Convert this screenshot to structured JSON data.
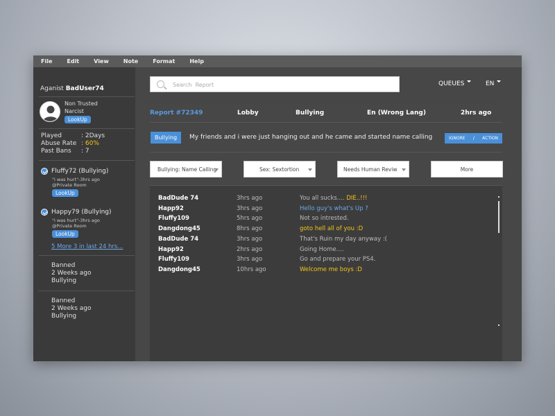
{
  "menu": [
    "File",
    "Edit",
    "View",
    "Note",
    "Format",
    "Help"
  ],
  "sidebar": {
    "against_prefix": "Aganist",
    "against_user": "BadUser74",
    "trust_label": "Non Trusted",
    "personality": "Narcist",
    "lookup_label": "LookUp",
    "stats": [
      {
        "label": "Played",
        "value": ": 2Days"
      },
      {
        "label": "Abuse Rate",
        "value": ": 60%"
      },
      {
        "label": "Past Bans",
        "value": ": 7"
      }
    ],
    "reports": [
      {
        "user": "Fluffy72 (Bullying)",
        "quote": "\"i was hurt\"-3hrs ago",
        "room": "@Private Room",
        "lookup": "LookUp"
      },
      {
        "user": "Happy79 (Bullying)",
        "quote": "\"i was hurt\"-3hrs ago",
        "room": "@Private Room",
        "lookup": "LookUp"
      }
    ],
    "more_link": "5 More 3 in last 24 hrs...",
    "bans": [
      {
        "status": "Banned",
        "when": "2 Weeks ago",
        "reason": "Bullying"
      },
      {
        "status": "Banned",
        "when": "2 Weeks ago",
        "reason": "Bullying"
      }
    ]
  },
  "header": {
    "search_placeholder": "Search  Report",
    "queues_label": "QUEUES",
    "lang_label": "EN"
  },
  "report": {
    "id": "Report #72349",
    "location": "Lobby",
    "category": "Bullying",
    "language": "En (Wrong Lang)",
    "age": "2hrs ago",
    "tag": "Bullying",
    "text": "My friends and i were just hanging out and he came and started name calling",
    "ignore_label": "IGNORE",
    "separator": "/",
    "action_label": "ACTION"
  },
  "filters": [
    {
      "label": "Bullying: Name Calling",
      "has_caret": true
    },
    {
      "label": "Sex: Sextortion",
      "has_caret": true
    },
    {
      "label": "Needs Human Reviw",
      "has_caret": true
    },
    {
      "label": "More",
      "has_caret": false
    }
  ],
  "chat": [
    {
      "name": "BadDude 74",
      "time": "3hrs ago",
      "msg": "You all sucks.... ",
      "highlight": "DIE..!!!",
      "color": "#bdbdbd"
    },
    {
      "name": "Happ92",
      "time": "3hrs ago",
      "msg": "Hello guy's what's Up ?",
      "highlight": "",
      "color": "#6fa8e8"
    },
    {
      "name": "Fluffy109",
      "time": "5hrs ago",
      "msg": "Not so intrested.",
      "highlight": "",
      "color": "#bdbdbd"
    },
    {
      "name": "Dangdong45",
      "time": "8hrs ago",
      "msg": "goto hell all of you :D",
      "highlight": "",
      "color": "#f5c518"
    },
    {
      "name": "BadDude 74",
      "time": "3hrs ago",
      "msg": "That's Ruin my day anyway :(",
      "highlight": "",
      "color": "#bdbdbd"
    },
    {
      "name": "Happ92",
      "time": "2hrs ago",
      "msg": "Going Home....",
      "highlight": "",
      "color": "#bdbdbd"
    },
    {
      "name": "Fluffy109",
      "time": "3hrs ago",
      "msg": "Go and prepare your PS4.",
      "highlight": "",
      "color": "#bdbdbd"
    },
    {
      "name": "Dangdong45",
      "time": "10hrs ago",
      "msg": "Welcome me boys :D",
      "highlight": "",
      "color": "#f5c518"
    }
  ],
  "colors": {
    "accent": "#4a90d9",
    "warning": "#f5c518",
    "link": "#6fa8e8"
  }
}
